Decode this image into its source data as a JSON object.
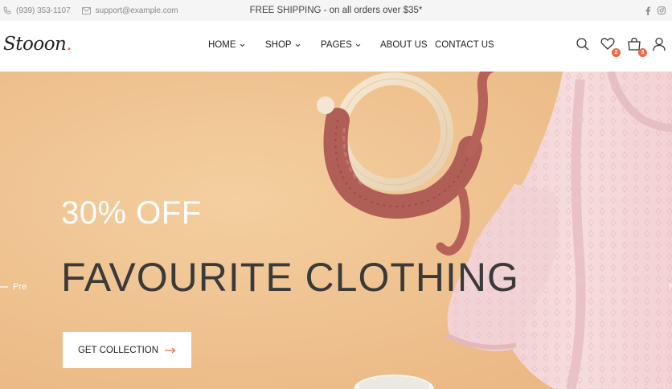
{
  "topbar": {
    "phone": "(939) 353-1107",
    "email": "support@example.com",
    "announcement": "FREE SHIPPING - on all orders over $35*",
    "social": [
      "facebook-icon",
      "instagram-icon"
    ]
  },
  "header": {
    "logo": "Stooon",
    "logo_dot": ".",
    "nav": [
      {
        "label": "HOME",
        "dropdown": true
      },
      {
        "label": "SHOP",
        "dropdown": true
      },
      {
        "label": "PAGES",
        "dropdown": true
      },
      {
        "label": "ABOUT US",
        "dropdown": false
      },
      {
        "label": "CONTACT US",
        "dropdown": false
      }
    ],
    "icons": [
      "search-icon",
      "wishlist-icon",
      "cart-icon",
      "user-icon"
    ],
    "wishlist_count": "2",
    "cart_count": "3"
  },
  "hero": {
    "subtitle": "30% OFF",
    "title": "FAVOURITE CLOTHING",
    "cta_label": "GET COLLECTION",
    "prev_label": "Pre",
    "next_label": "N"
  },
  "colors": {
    "accent": "#e96b4b",
    "hero_bg": "#f0c490",
    "topbar_bg": "#f5f5f5"
  }
}
